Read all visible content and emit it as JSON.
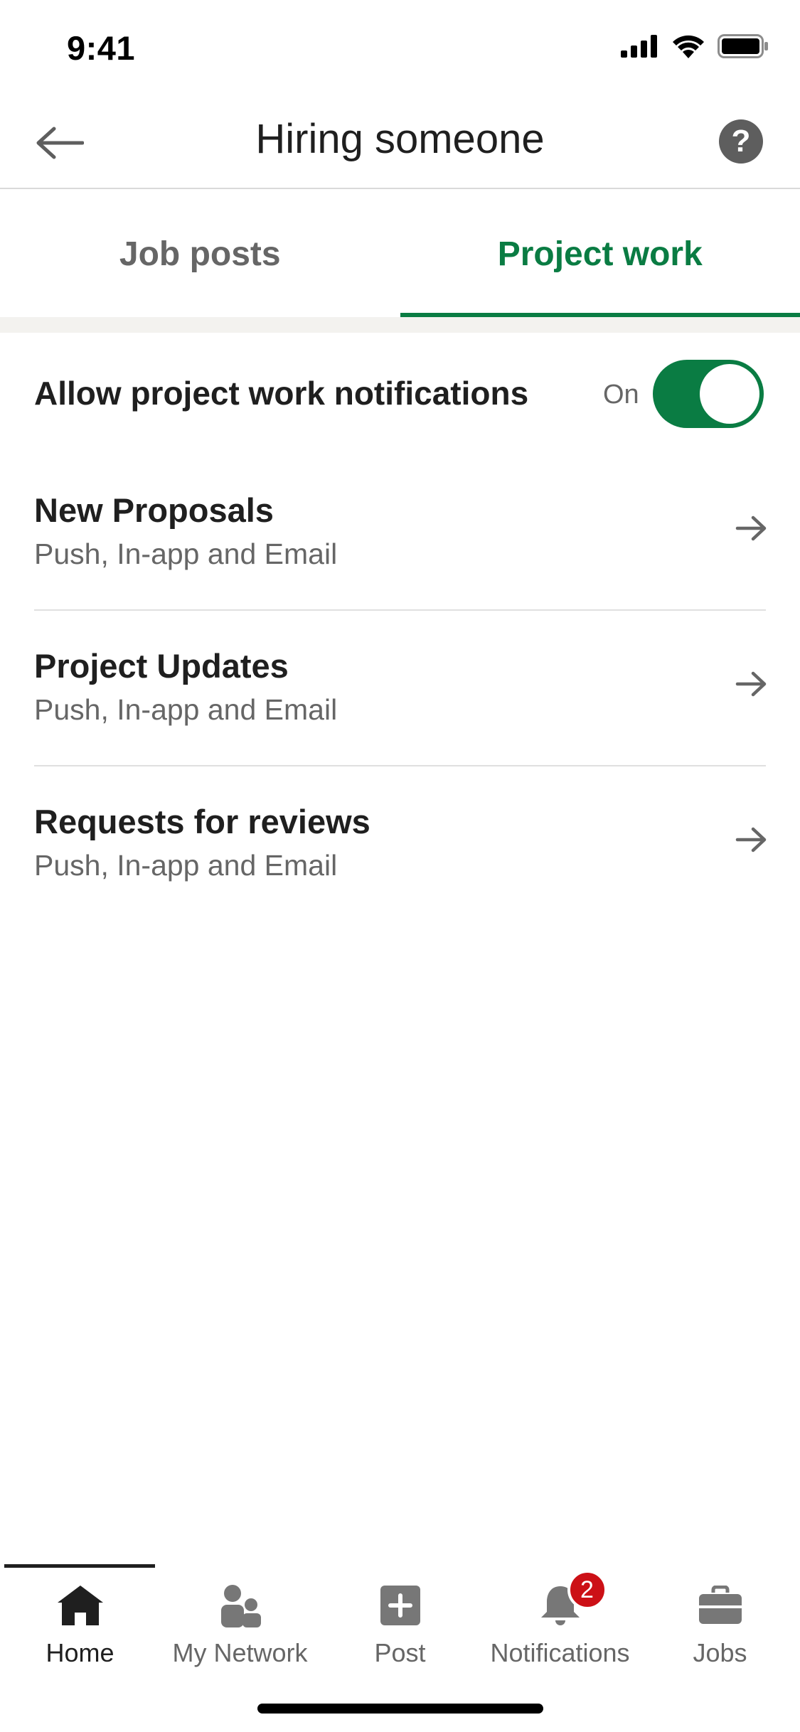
{
  "status_bar": {
    "time": "9:41"
  },
  "header": {
    "title": "Hiring someone",
    "help_glyph": "?"
  },
  "tabs": [
    {
      "label": "Job posts",
      "active": false
    },
    {
      "label": "Project work",
      "active": true
    }
  ],
  "toggle_row": {
    "label": "Allow project work notifications",
    "state": "On",
    "enabled": true
  },
  "items": [
    {
      "title": "New Proposals",
      "subtitle": "Push, In-app and Email"
    },
    {
      "title": "Project Updates",
      "subtitle": "Push, In-app and Email"
    },
    {
      "title": "Requests for reviews",
      "subtitle": "Push, In-app and Email"
    }
  ],
  "bottom_nav": {
    "items": [
      {
        "label": "Home",
        "icon": "home-icon",
        "active": true
      },
      {
        "label": "My Network",
        "icon": "network-icon",
        "active": false
      },
      {
        "label": "Post",
        "icon": "post-icon",
        "active": false
      },
      {
        "label": "Notifications",
        "icon": "bell-icon",
        "active": false,
        "badge": "2"
      },
      {
        "label": "Jobs",
        "icon": "briefcase-icon",
        "active": false
      }
    ]
  },
  "colors": {
    "accent": "#0a7c43",
    "badge": "#cc1016",
    "text": "#1f1f1f",
    "muted": "#666666"
  }
}
